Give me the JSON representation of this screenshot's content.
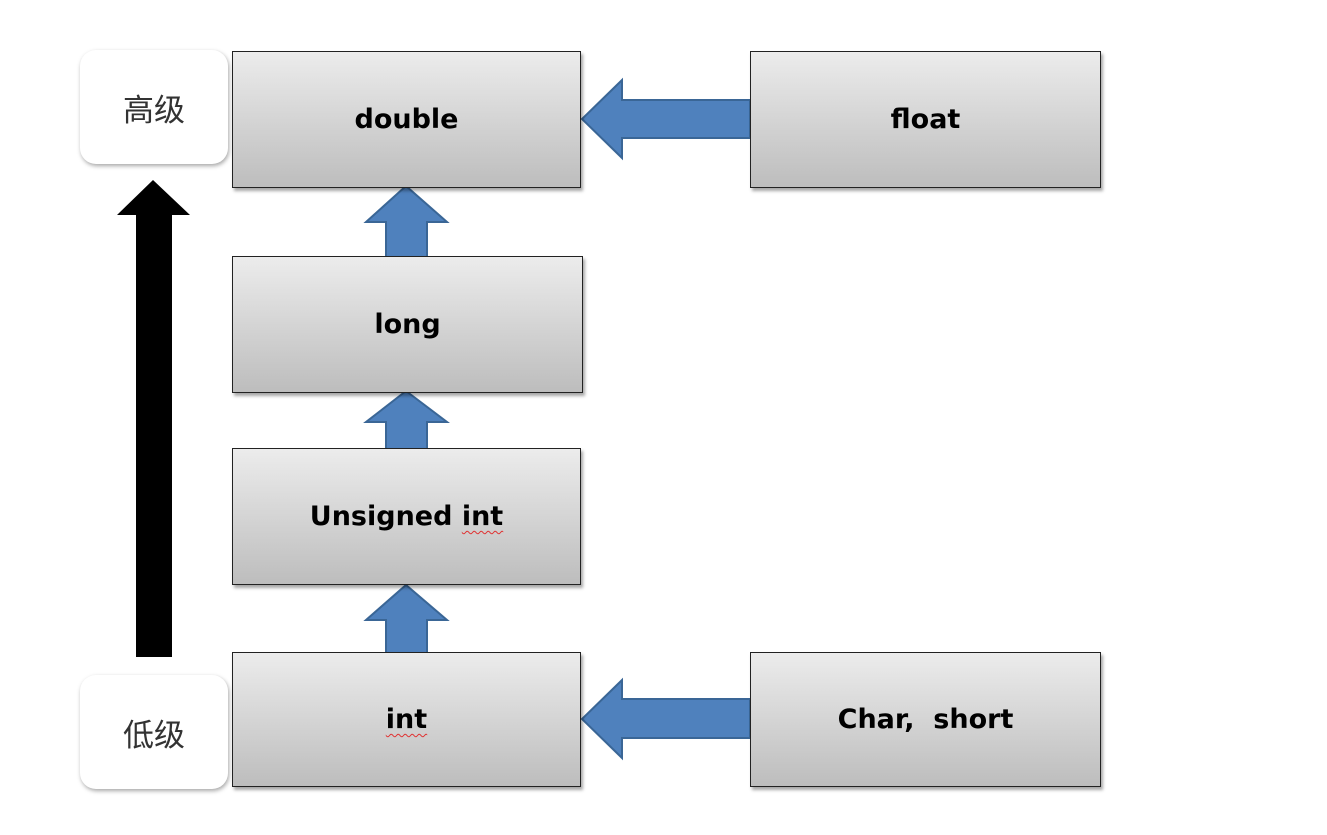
{
  "levels": {
    "high": "高级",
    "low": "低级"
  },
  "types": {
    "double": "double",
    "float": "float",
    "long": "long",
    "unsigned_int": {
      "prefix": "Unsigned ",
      "word": "int"
    },
    "int": "int",
    "char_short": "Char,  short"
  },
  "colors": {
    "arrow_fill": "#4f81bd",
    "arrow_stroke": "#3a6696",
    "level_arrow": "#000000"
  }
}
